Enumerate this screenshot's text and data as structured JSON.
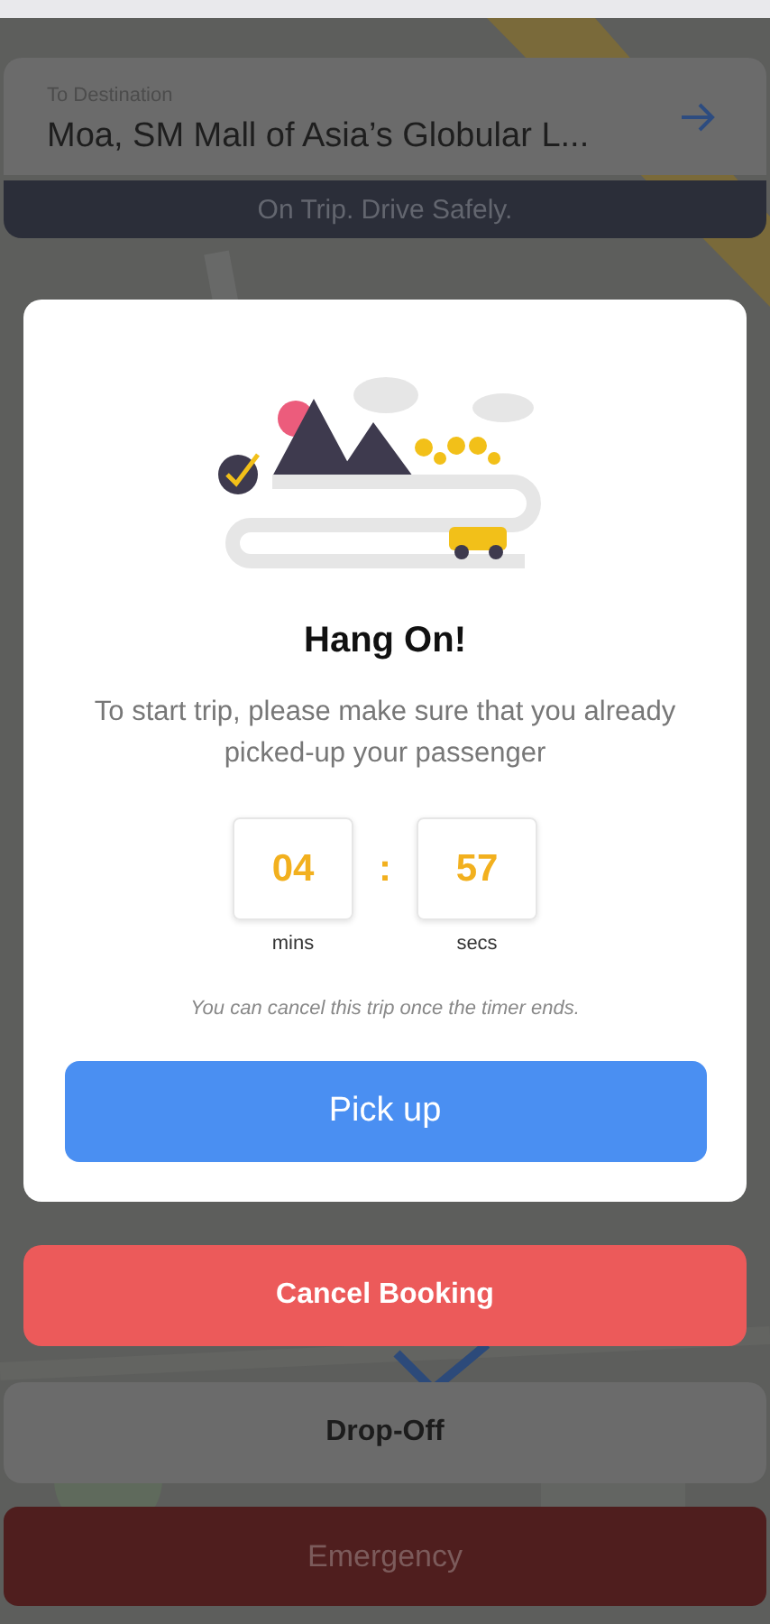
{
  "destination": {
    "label": "To Destination",
    "address": "Moa, SM Mall of Asia’s Globular L..."
  },
  "trip_status": "On Trip. Drive Safely.",
  "modal": {
    "title": "Hang On!",
    "message": "To start trip, please make sure that you already picked-up your passenger",
    "timer": [
      {
        "value": "04",
        "unit": "mins"
      },
      {
        "value": "57",
        "unit": "secs"
      }
    ],
    "separator": ":",
    "note": "You can cancel this trip once the timer ends.",
    "primary_button": "Pick up"
  },
  "cancel_button": "Cancel Booking",
  "drop_off_button": "Drop-Off",
  "emergency_button": "Emergency"
}
